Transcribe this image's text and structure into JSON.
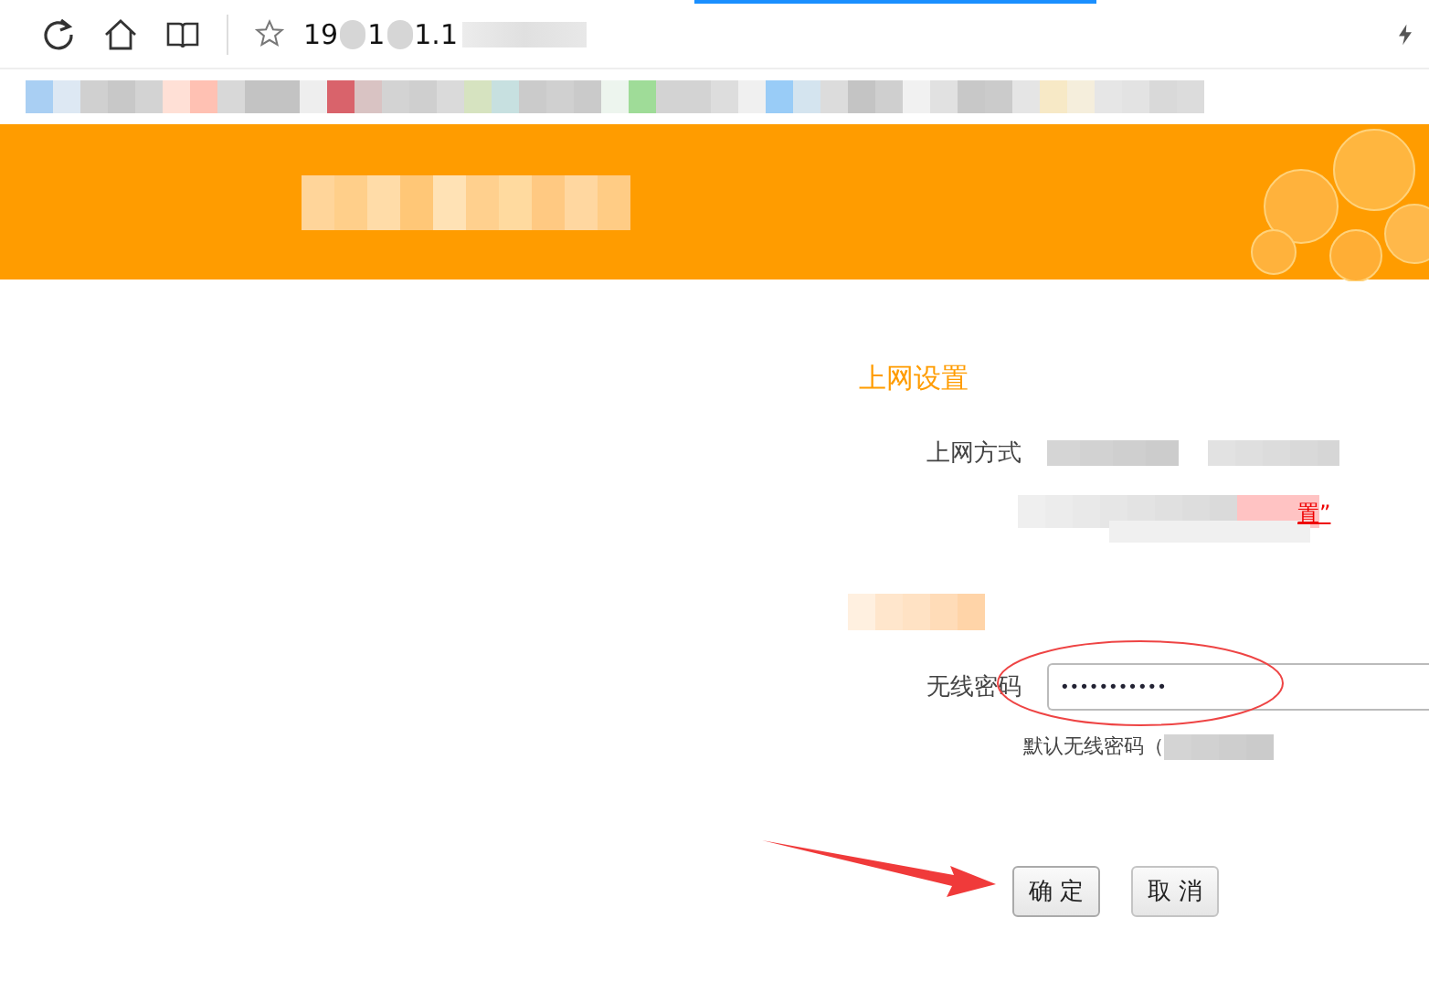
{
  "toolbar": {
    "address_parts": [
      "19",
      "1",
      "1.1"
    ]
  },
  "form": {
    "section_title": "上网设置",
    "connection": {
      "label": "上网方式",
      "note_link": "置”"
    },
    "password": {
      "label": "无线密码",
      "value": "•••••••••••",
      "hint": "默认无线密码（"
    },
    "buttons": [
      {
        "label": "确 定",
        "kind": "primary"
      },
      {
        "label": "取 消",
        "kind": "secondary"
      }
    ]
  }
}
